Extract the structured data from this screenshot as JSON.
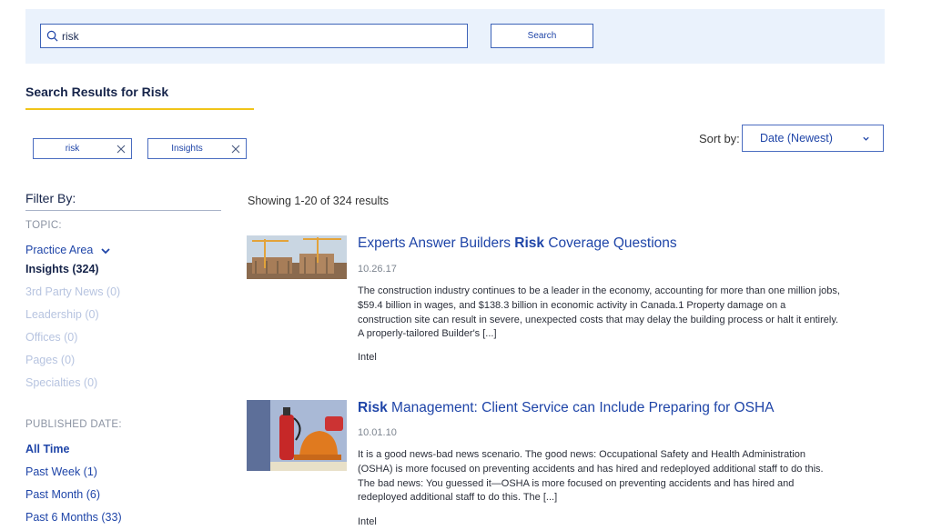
{
  "search": {
    "query": "risk",
    "button_label": "Search"
  },
  "results_title": "Search Results for Risk",
  "active_filters": [
    {
      "label": "risk"
    },
    {
      "label": "Insights"
    }
  ],
  "sort": {
    "label": "Sort by:",
    "selected": "Date (Newest)"
  },
  "filter": {
    "heading": "Filter By:",
    "topic_label": "TOPIC:",
    "practice_area_label": "Practice Area",
    "topic_items": [
      "Insights (324)",
      "3rd Party News (0)",
      "Leadership (0)",
      "Offices (0)",
      "Pages (0)",
      "Specialties (0)"
    ],
    "published_label": "PUBLISHED DATE:",
    "date_items": [
      "All Time",
      "Past Week (1)",
      "Past Month (6)",
      "Past 6 Months (33)"
    ]
  },
  "showing": "Showing 1-20 of 324 results",
  "results": [
    {
      "title_pre": "Experts Answer Builders ",
      "title_highlight": "Risk",
      "title_post": " Coverage Questions",
      "date": "10.26.17",
      "excerpt": "The construction industry continues to be a leader in the economy, accounting for more than one million jobs, $59.4 billion in wages, and $138.3 billion in economic activity in Canada.1 Property damage on a construction site can result in severe, unexpected costs that may delay the building process or halt it entirely. A properly-tailored Builder's [...]",
      "type": "Intel"
    },
    {
      "title_pre": "",
      "title_highlight": "Risk",
      "title_post": " Management: Client Service can Include Preparing for OSHA",
      "date": "10.01.10",
      "excerpt": "It is a good news-bad news scenario. The good news: Occupational Safety and Health Administration (OSHA) is more focused on preventing accidents and has hired and redeployed additional staff to do this. The bad news: You guessed it—OSHA is more focused on preventing accidents and has hired and redeployed additional staff to do this. The [...]",
      "type": "Intel"
    }
  ]
}
